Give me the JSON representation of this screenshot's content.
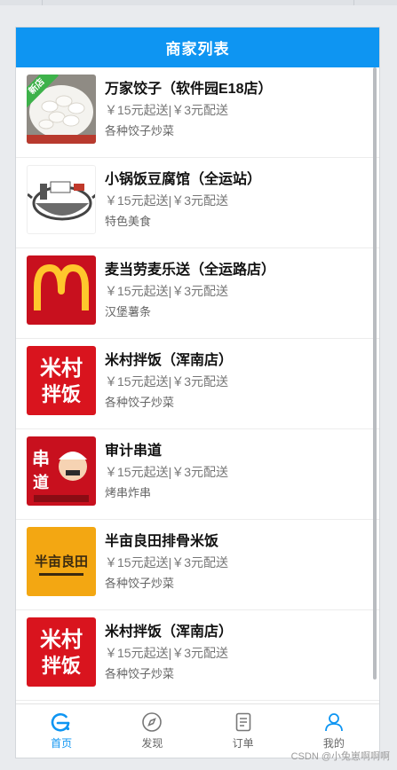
{
  "header": {
    "title": "商家列表"
  },
  "shops": [
    {
      "name": "万家饺子（软件园E18店）",
      "price": "￥15元起送|￥3元配送",
      "desc": "各种饺子炒菜",
      "badge": "新店"
    },
    {
      "name": "小锅饭豆腐馆（全运站）",
      "price": "￥15元起送|￥3元配送",
      "desc": "特色美食"
    },
    {
      "name": "麦当劳麦乐送（全运路店）",
      "price": "￥15元起送|￥3元配送",
      "desc": "汉堡薯条"
    },
    {
      "name": "米村拌饭（浑南店）",
      "price": "￥15元起送|￥3元配送",
      "desc": "各种饺子炒菜",
      "logo_text": [
        "米村",
        "拌饭"
      ]
    },
    {
      "name": "审计串道",
      "price": "￥15元起送|￥3元配送",
      "desc": "烤串炸串",
      "logo_text": [
        "串",
        "道"
      ]
    },
    {
      "name": "半亩良田排骨米饭",
      "price": "￥15元起送|￥3元配送",
      "desc": "各种饺子炒菜",
      "logo_text": "半亩良田"
    },
    {
      "name": "米村拌饭（浑南店）",
      "price": "￥15元起送|￥3元配送",
      "desc": "各种饺子炒菜",
      "logo_text": [
        "米村",
        "拌饭"
      ]
    }
  ],
  "tabs": [
    {
      "label": "首页",
      "icon": "home-e-icon",
      "active": true
    },
    {
      "label": "发现",
      "icon": "compass-icon",
      "active": false
    },
    {
      "label": "订单",
      "icon": "order-doc-icon",
      "active": false
    },
    {
      "label": "我的",
      "icon": "user-icon",
      "active": false
    }
  ],
  "watermark": "CSDN @小兔崽啊啊啊",
  "colors": {
    "primary": "#0e95f2",
    "mcd_red": "#c8101e",
    "mcd_yellow": "#ffc72c",
    "micun_red": "#d9141e",
    "banmu_yellow": "#f3a712"
  }
}
